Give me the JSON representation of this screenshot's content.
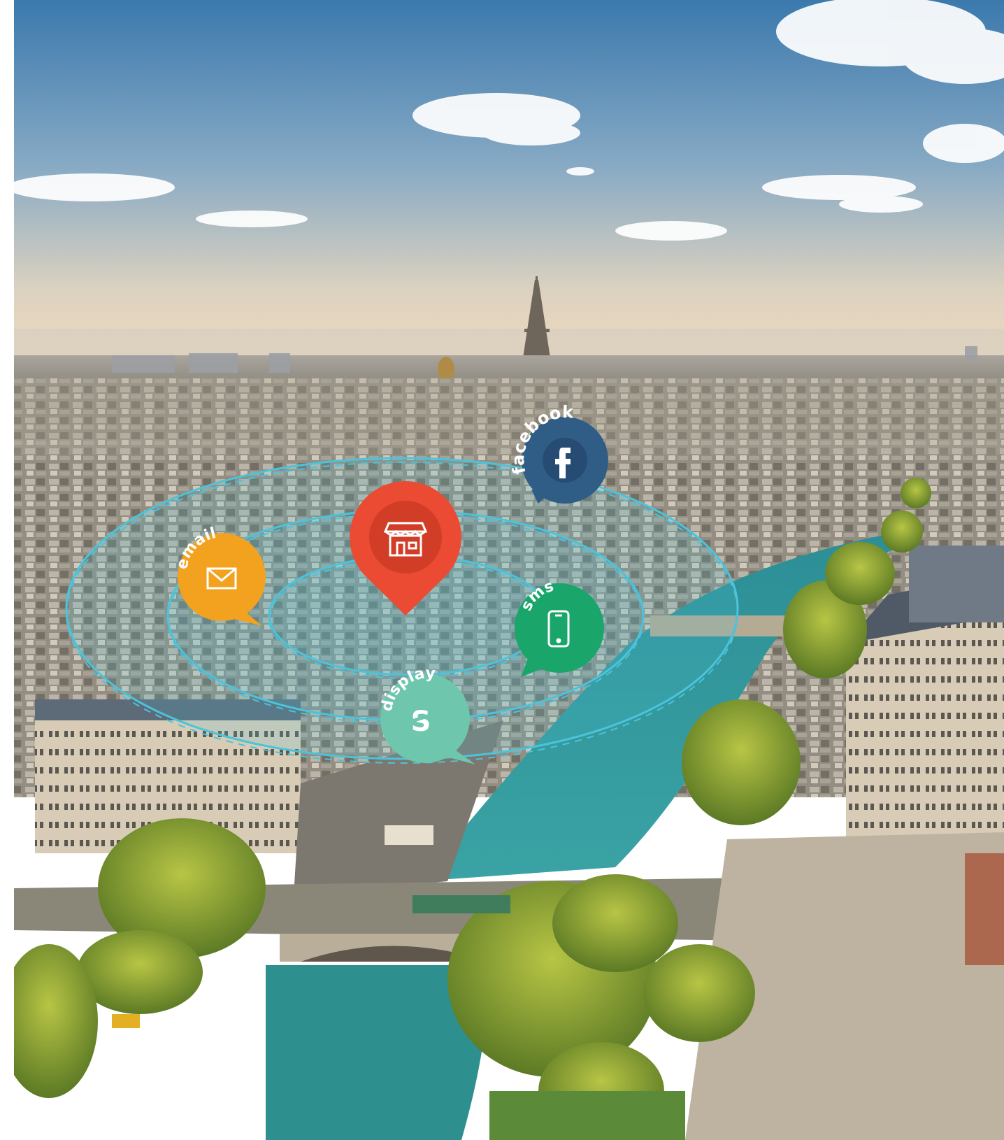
{
  "scene": {
    "description_free": true
  },
  "bubbles": {
    "facebook": {
      "label": "facebook",
      "color": "#2f5d86",
      "icon": "facebook-icon"
    },
    "email": {
      "label": "email",
      "color": "#f2a21e",
      "icon": "envelope-icon"
    },
    "sms": {
      "label": "sms",
      "color": "#1aa56b",
      "icon": "mobile-phone-icon"
    },
    "display": {
      "label": "display",
      "color": "#6ec6ad",
      "icon": "display-s-icon"
    },
    "store": {
      "color": "#ea4b32",
      "icon": "store-icon"
    }
  },
  "colors": {
    "radius_rings": "#4cc3da",
    "sky_top": "#3f7fb2",
    "sky_bottom": "#f0dcc0",
    "river": "#3f9ca0"
  }
}
